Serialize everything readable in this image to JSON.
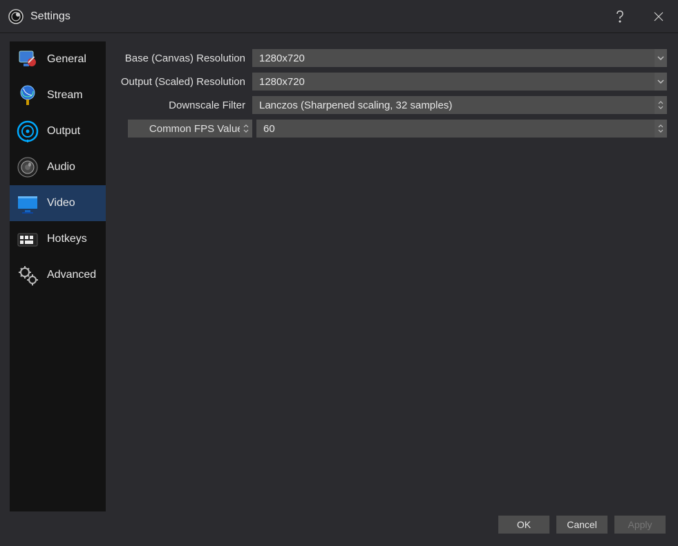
{
  "window_title": "Settings",
  "sidebar": {
    "items": [
      {
        "label": "General"
      },
      {
        "label": "Stream"
      },
      {
        "label": "Output"
      },
      {
        "label": "Audio"
      },
      {
        "label": "Video"
      },
      {
        "label": "Hotkeys"
      },
      {
        "label": "Advanced"
      }
    ],
    "selected_index": 4
  },
  "video_settings": {
    "base_res_label": "Base (Canvas) Resolution",
    "base_res_value": "1280x720",
    "output_res_label": "Output (Scaled) Resolution",
    "output_res_value": "1280x720",
    "downscale_label": "Downscale Filter",
    "downscale_value": "Lanczos (Sharpened scaling, 32 samples)",
    "fps_type_label": "Common FPS Values",
    "fps_value": "60"
  },
  "footer": {
    "ok_label": "OK",
    "cancel_label": "Cancel",
    "apply_label": "Apply"
  }
}
